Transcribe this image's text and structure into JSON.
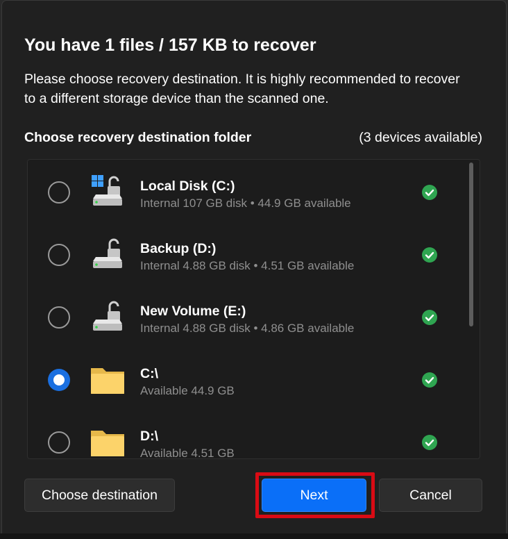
{
  "dialog": {
    "title": "You have 1 files / 157 KB to recover",
    "description": "Please choose recovery destination. It is highly recommended to recover to a different storage device than the scanned one.",
    "section_title": "Choose recovery destination folder",
    "devices_count": "(3 devices available)"
  },
  "destinations": [
    {
      "name": "Local Disk (C:)",
      "sub": "Internal 107 GB disk • 44.9 GB available",
      "icon": "windows-drive-icon",
      "selected": false
    },
    {
      "name": "Backup (D:)",
      "sub": "Internal 4.88 GB disk • 4.51 GB available",
      "icon": "drive-icon",
      "selected": false
    },
    {
      "name": "New Volume (E:)",
      "sub": "Internal 4.88 GB disk • 4.86 GB available",
      "icon": "drive-icon",
      "selected": false
    },
    {
      "name": "C:\\",
      "sub": "Available 44.9 GB",
      "icon": "folder-icon",
      "selected": true
    },
    {
      "name": "D:\\",
      "sub": "Available 4.51 GB",
      "icon": "folder-icon",
      "selected": false
    }
  ],
  "buttons": {
    "choose_destination": "Choose destination",
    "next": "Next",
    "cancel": "Cancel"
  },
  "colors": {
    "background": "#202020",
    "accent": "#0a6ff8",
    "ok_green": "#2fa551",
    "highlight_red": "#d90b14",
    "subtext": "#8f8f8f"
  }
}
